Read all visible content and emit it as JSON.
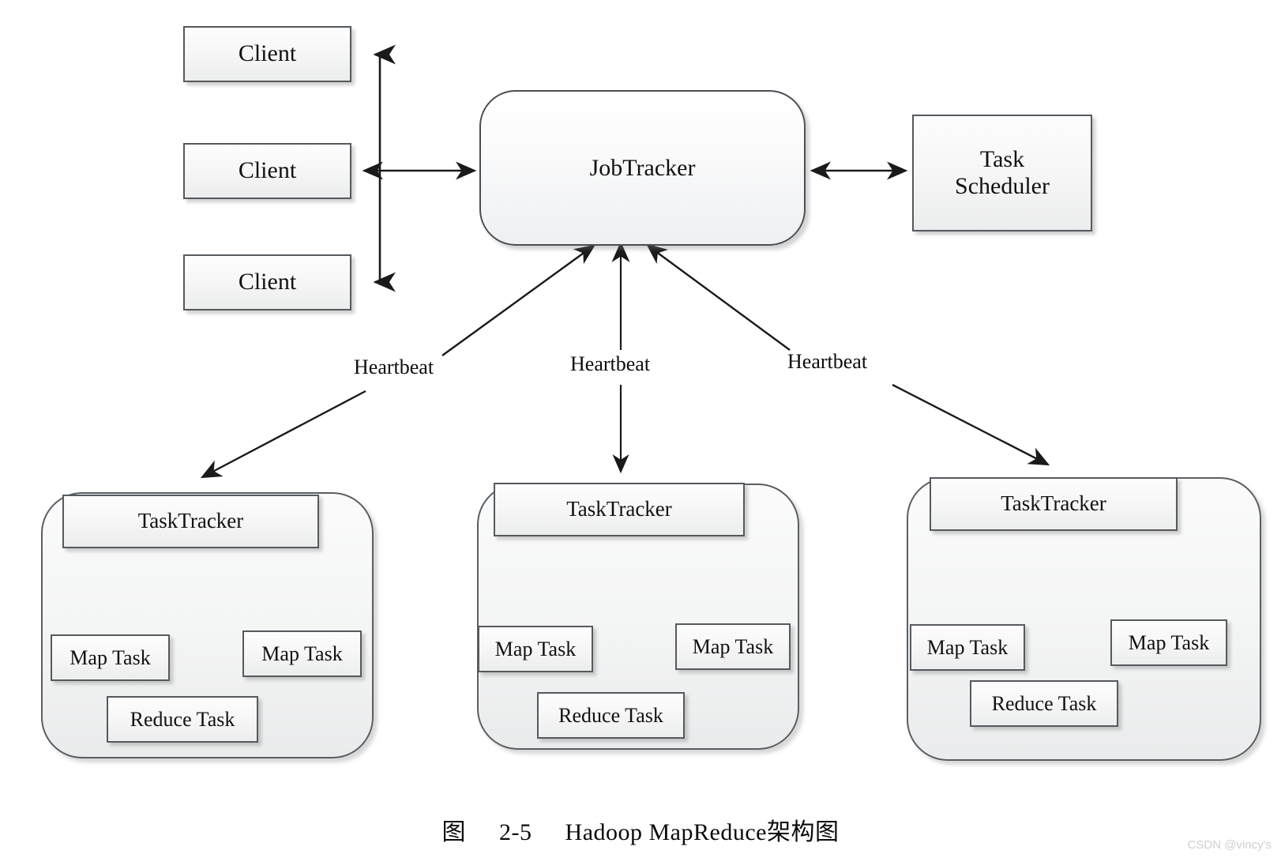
{
  "figure": {
    "caption_prefix": "图",
    "caption_number": "2-5",
    "caption_title": "Hadoop MapReduce架构图",
    "watermark": "CSDN @vincy's",
    "background_color": "#ffffff",
    "node_border_color": "#555a5f",
    "edge_color": "#1a1a1a"
  },
  "nodes": {
    "clients": [
      {
        "label": "Client"
      },
      {
        "label": "Client"
      },
      {
        "label": "Client"
      }
    ],
    "job_tracker": {
      "label": "JobTracker"
    },
    "task_scheduler": {
      "label": "Task\nScheduler",
      "line1": "Task",
      "line2": "Scheduler"
    },
    "clusters": [
      {
        "task_tracker": {
          "label": "TaskTracker"
        },
        "map_task_left": {
          "label": "Map Task"
        },
        "map_task_right": {
          "label": "Map Task"
        },
        "reduce_task": {
          "label": "Reduce Task"
        }
      },
      {
        "task_tracker": {
          "label": "TaskTracker"
        },
        "map_task_left": {
          "label": "Map Task"
        },
        "map_task_right": {
          "label": "Map Task"
        },
        "reduce_task": {
          "label": "Reduce Task"
        }
      },
      {
        "task_tracker": {
          "label": "TaskTracker"
        },
        "map_task_left": {
          "label": "Map Task"
        },
        "map_task_right": {
          "label": "Map Task"
        },
        "reduce_task": {
          "label": "Reduce Task"
        }
      }
    ]
  },
  "edges": {
    "heartbeat_labels": [
      {
        "label": "Heartbeat"
      },
      {
        "label": "Heartbeat"
      },
      {
        "label": "Heartbeat"
      }
    ]
  },
  "chart_data": {
    "type": "diagram",
    "title": "图 2-5  Hadoop MapReduce架构图",
    "diagram_kind": "architecture-block-diagram",
    "node_list": [
      "Client",
      "Client",
      "Client",
      "JobTracker",
      "Task Scheduler",
      "TaskTracker",
      "Map Task",
      "Map Task",
      "Reduce Task",
      "TaskTracker",
      "Map Task",
      "Map Task",
      "Reduce Task",
      "TaskTracker",
      "Map Task",
      "Map Task",
      "Reduce Task"
    ],
    "connections": [
      {
        "from": "Client 1",
        "to": "JobTracker",
        "direction": "bidirectional",
        "label": ""
      },
      {
        "from": "Client 2",
        "to": "JobTracker",
        "direction": "bidirectional",
        "label": ""
      },
      {
        "from": "Client 3",
        "to": "JobTracker",
        "direction": "bidirectional",
        "label": ""
      },
      {
        "from": "JobTracker",
        "to": "Task Scheduler",
        "direction": "bidirectional",
        "label": ""
      },
      {
        "from": "TaskTracker 1",
        "to": "JobTracker",
        "direction": "bidirectional",
        "label": "Heartbeat"
      },
      {
        "from": "TaskTracker 2",
        "to": "JobTracker",
        "direction": "bidirectional",
        "label": "Heartbeat"
      },
      {
        "from": "TaskTracker 3",
        "to": "JobTracker",
        "direction": "bidirectional",
        "label": "Heartbeat"
      },
      {
        "from": "TaskTracker 1",
        "to": "Map Task (left)",
        "direction": "bidirectional",
        "label": ""
      },
      {
        "from": "TaskTracker 1",
        "to": "Map Task (right)",
        "direction": "bidirectional",
        "label": ""
      },
      {
        "from": "TaskTracker 1",
        "to": "Reduce Task",
        "direction": "bidirectional",
        "label": ""
      },
      {
        "from": "TaskTracker 2",
        "to": "Map Task (left)",
        "direction": "bidirectional",
        "label": ""
      },
      {
        "from": "TaskTracker 2",
        "to": "Map Task (right)",
        "direction": "bidirectional",
        "label": ""
      },
      {
        "from": "TaskTracker 2",
        "to": "Reduce Task",
        "direction": "bidirectional",
        "label": ""
      },
      {
        "from": "TaskTracker 3",
        "to": "Map Task (left)",
        "direction": "bidirectional",
        "label": ""
      },
      {
        "from": "TaskTracker 3",
        "to": "Map Task (right)",
        "direction": "bidirectional",
        "label": ""
      },
      {
        "from": "TaskTracker 3",
        "to": "Reduce Task",
        "direction": "bidirectional",
        "label": ""
      }
    ]
  }
}
